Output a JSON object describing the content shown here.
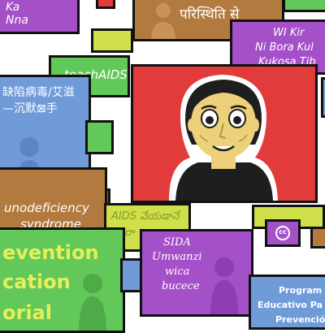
{
  "colors": {
    "background": "#ffffff",
    "outline": "#111111",
    "purple": "#a450c8",
    "brown": "#b27a3e",
    "lightBlue": "#6f9bd8",
    "green": "#62c85a",
    "lime": "#cfe04a",
    "red": "#e23b3b",
    "skin": "#ecd07a",
    "hair": "#1e1e1e"
  },
  "cards": {
    "tl": {
      "line1": "Ka",
      "line2": "Nna"
    },
    "topCenter": {
      "text": "परिस्थिति से"
    },
    "topRight": {
      "line1": "WI Kir",
      "line2": "Ni Bora Kul",
      "line3": "Kukosa Tib"
    },
    "teachaids": {
      "text": "teachAIDS"
    },
    "chinese": {
      "line1": "缺陷病毒/艾滋",
      "line2": "—沉默⊠手"
    },
    "immuno": {
      "line1": "unodeficiency",
      "line2": "syndrome"
    },
    "telugu": {
      "line1": "AIDS వేయడానే",
      "line2": "ూరా"
    },
    "prevention": {
      "line1": "evention",
      "line2": "cation",
      "line3": "orial"
    },
    "sida": {
      "line1": "SIDA",
      "line2": "Umwanzi",
      "line3": "wica",
      "line4": "bucece"
    },
    "programa": {
      "line1": "Program",
      "line2": "Educativo Pa",
      "line3": "Prevenció"
    },
    "cc": {
      "text": "cc"
    }
  }
}
